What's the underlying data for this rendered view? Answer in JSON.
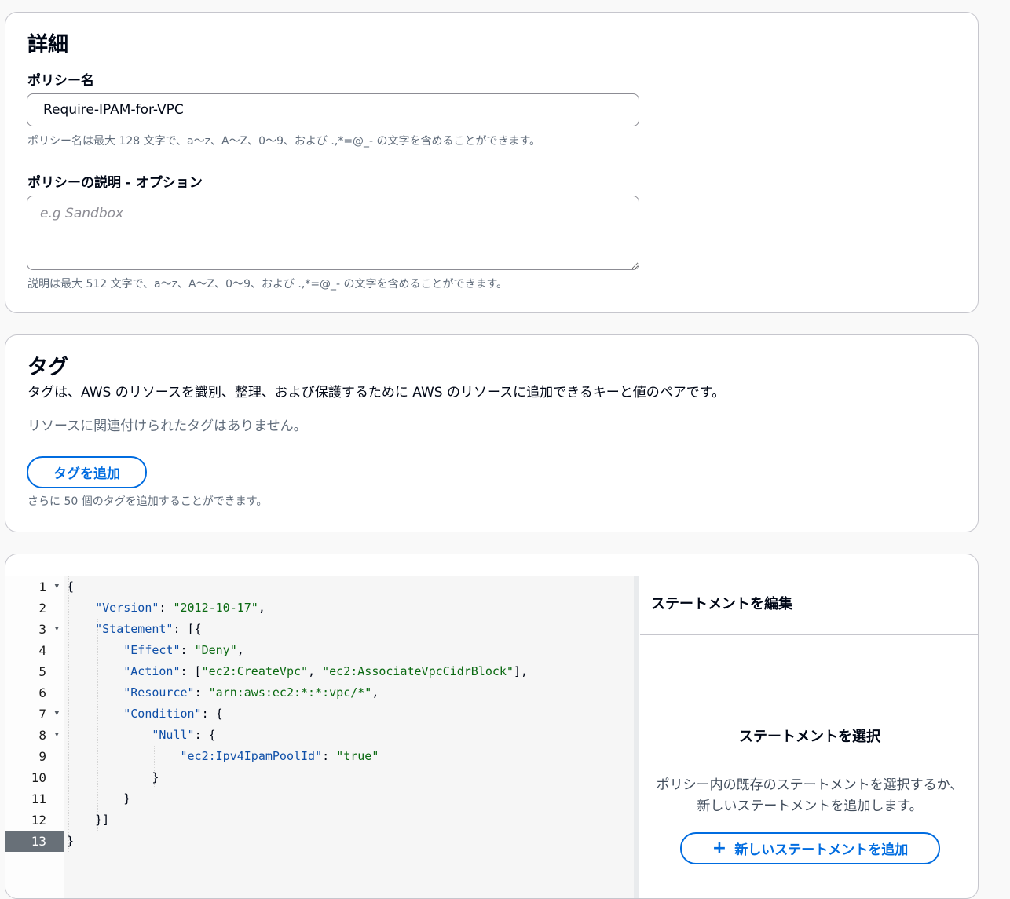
{
  "details": {
    "title": "詳細",
    "policy_name_label": "ポリシー名",
    "policy_name_value": "Require-IPAM-for-VPC",
    "policy_name_hint": "ポリシー名は最大 128 文字で、a〜z、A〜Z、0〜9、および .,*=@_- の文字を含めることができます。",
    "description_label": "ポリシーの説明 - オプション",
    "description_placeholder": "e.g Sandbox",
    "description_hint": "説明は最大 512 文字で、a〜z、A〜Z、0〜9、および .,*=@_- の文字を含めることができます。"
  },
  "tags": {
    "title": "タグ",
    "description": "タグは、AWS のリソースを識別、整理、および保護するために AWS のリソースに追加できるキーと値のペアです。",
    "empty_text": "リソースに関連付けられたタグはありません。",
    "add_button_label": "タグを追加",
    "limit_hint": "さらに 50 個のタグを追加することができます。"
  },
  "editor": {
    "active_line": 13,
    "lines": [
      {
        "num": "1",
        "text": "{",
        "fold": true
      },
      {
        "num": "2",
        "text": "    \"Version\": \"2012-10-17\",",
        "fold": false
      },
      {
        "num": "3",
        "text": "    \"Statement\": [{",
        "fold": true
      },
      {
        "num": "4",
        "text": "        \"Effect\": \"Deny\",",
        "fold": false
      },
      {
        "num": "5",
        "text": "        \"Action\": [\"ec2:CreateVpc\", \"ec2:AssociateVpcCidrBlock\"],",
        "fold": false
      },
      {
        "num": "6",
        "text": "        \"Resource\": \"arn:aws:ec2:*:*:vpc/*\",",
        "fold": false
      },
      {
        "num": "7",
        "text": "        \"Condition\": {",
        "fold": true
      },
      {
        "num": "8",
        "text": "            \"Null\": {",
        "fold": true
      },
      {
        "num": "9",
        "text": "                \"ec2:Ipv4IpamPoolId\": \"true\"",
        "fold": false
      },
      {
        "num": "10",
        "text": "            }",
        "fold": false
      },
      {
        "num": "11",
        "text": "        }",
        "fold": false
      },
      {
        "num": "12",
        "text": "    }]",
        "fold": false
      },
      {
        "num": "13",
        "text": "}",
        "fold": false
      }
    ]
  },
  "statement_panel": {
    "header": "ステートメントを編集",
    "select_title": "ステートメントを選択",
    "select_description": "ポリシー内の既存のステートメントを選択するか、新しいステートメントを追加します。",
    "add_button_label": "新しいステートメントを追加",
    "add_icon": "plus-icon"
  }
}
